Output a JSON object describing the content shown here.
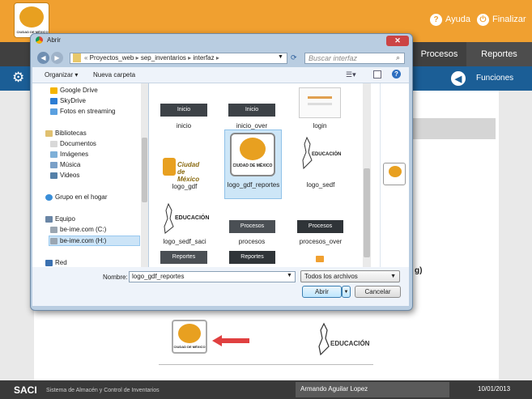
{
  "app": {
    "logo_text": "CIUDAD DE MÉXICO",
    "help_label": "Ayuda",
    "finish_label": "Finalizar",
    "nav_tabs": [
      "Procesos",
      "Reportes"
    ],
    "functions_label": "Funciones",
    "partial_text": "g)",
    "status_brand": "SACI",
    "status_subtitle": "Sistema de Almacén y Control de Inventarios",
    "status_user": "Armando Aguilar Lopez",
    "status_date": "10/01/2013",
    "colors": {
      "orange": "#f0a030",
      "nav": "#404040",
      "blue": "#1b5e96",
      "arrow": "#e04040"
    }
  },
  "dialog": {
    "title": "Abrir",
    "breadcrumb": [
      "Proyectos_web",
      "sep_inventarios",
      "interfaz"
    ],
    "search_placeholder": "Buscar interfaz",
    "organize_label": "Organizar",
    "new_folder_label": "Nueva carpeta",
    "nav_items": [
      {
        "label": "Google Drive",
        "icon": "google-drive-icon"
      },
      {
        "label": "SkyDrive",
        "icon": "skydrive-icon"
      },
      {
        "label": "Fotos en streaming",
        "icon": "photo-stream-icon"
      },
      {
        "label": "Bibliotecas",
        "icon": "libraries-icon"
      },
      {
        "label": "Documentos",
        "icon": "documents-icon"
      },
      {
        "label": "Imágenes",
        "icon": "images-icon"
      },
      {
        "label": "Música",
        "icon": "music-icon"
      },
      {
        "label": "Videos",
        "icon": "videos-icon"
      },
      {
        "label": "Grupo en el hogar",
        "icon": "homegroup-icon"
      },
      {
        "label": "Equipo",
        "icon": "computer-icon"
      },
      {
        "label": "be-ime.com (C:)",
        "icon": "drive-icon"
      },
      {
        "label": "be-ime.com (H:)",
        "icon": "drive-icon"
      },
      {
        "label": "Red",
        "icon": "network-icon"
      }
    ],
    "files": [
      {
        "name": "inicio",
        "thumb": "Inicio"
      },
      {
        "name": "inicio_over",
        "thumb": "Inicio"
      },
      {
        "name": "login",
        "thumb": ""
      },
      {
        "name": "logo_gdf",
        "thumb": "Ciudad de México"
      },
      {
        "name": "logo_gdf_reportes",
        "thumb": "CIUDAD DE MÉXICO"
      },
      {
        "name": "logo_sedf",
        "thumb": "EDUCACIÓN"
      },
      {
        "name": "logo_sedf_saci",
        "thumb": "EDUCACIÓN"
      },
      {
        "name": "procesos",
        "thumb": "Procesos"
      },
      {
        "name": "procesos_over",
        "thumb": "Procesos"
      },
      {
        "name": "",
        "thumb": "Reportes"
      },
      {
        "name": "",
        "thumb": "Reportes"
      }
    ],
    "filename_label": "Nombre:",
    "filename_value": "logo_gdf_reportes",
    "filetype_value": "Todos los archivos",
    "open_label": "Abrir",
    "cancel_label": "Cancelar"
  },
  "preview": {
    "logo_text": "CIUDAD DE MÉXICO",
    "edu_text": "EDUCACIÓN"
  }
}
